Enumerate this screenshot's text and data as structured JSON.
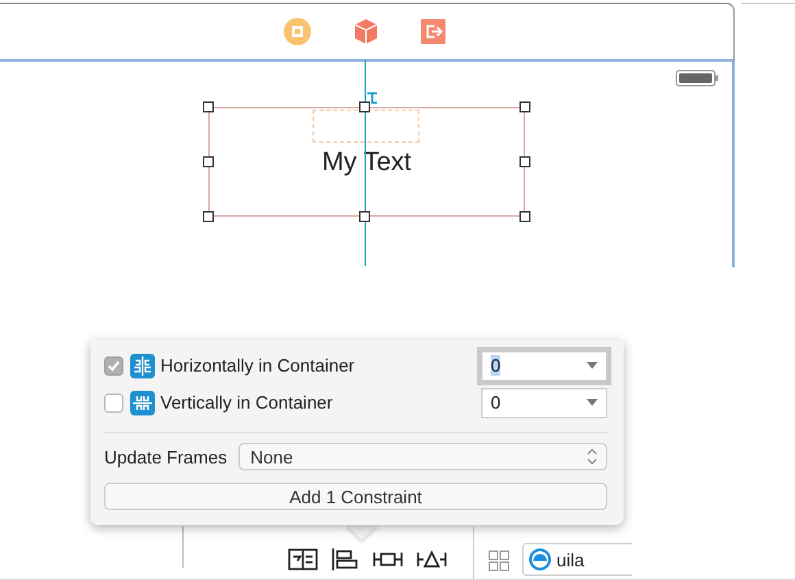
{
  "scene": {
    "label": "My Text"
  },
  "popover": {
    "options": [
      {
        "label": "Horizontally in Container",
        "checked": true,
        "value": "0",
        "focused": true
      },
      {
        "label": "Vertically in Container",
        "checked": false,
        "value": "0",
        "focused": false
      }
    ],
    "update_frames": {
      "label": "Update Frames",
      "value": "None"
    },
    "add_button": "Add 1 Constraint"
  },
  "bottom_bar": {
    "field_value": "uila"
  }
}
